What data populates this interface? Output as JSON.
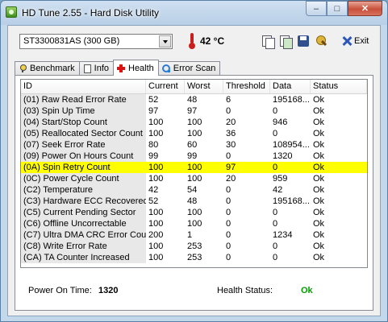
{
  "window": {
    "title": "HD Tune 2.55 - Hard Disk Utility"
  },
  "toolbar": {
    "drive": "ST3300831AS (300 GB)",
    "temperature": "42 °C",
    "exit_label": "Exit"
  },
  "tabs": [
    {
      "label": "Benchmark"
    },
    {
      "label": "Info"
    },
    {
      "label": "Health"
    },
    {
      "label": "Error Scan"
    }
  ],
  "health": {
    "columns": [
      "ID",
      "Current",
      "Worst",
      "Threshold",
      "Data",
      "Status"
    ],
    "rows": [
      [
        "(01) Raw Read Error Rate",
        "52",
        "48",
        "6",
        "195168...",
        "Ok"
      ],
      [
        "(03) Spin Up Time",
        "97",
        "97",
        "0",
        "0",
        "Ok"
      ],
      [
        "(04) Start/Stop Count",
        "100",
        "100",
        "20",
        "946",
        "Ok"
      ],
      [
        "(05) Reallocated Sector Count",
        "100",
        "100",
        "36",
        "0",
        "Ok"
      ],
      [
        "(07) Seek Error Rate",
        "80",
        "60",
        "30",
        "108954...",
        "Ok"
      ],
      [
        "(09) Power On Hours Count",
        "99",
        "99",
        "0",
        "1320",
        "Ok"
      ],
      [
        "(0A) Spin Retry Count",
        "100",
        "100",
        "97",
        "0",
        "Ok"
      ],
      [
        "(0C) Power Cycle Count",
        "100",
        "100",
        "20",
        "959",
        "Ok"
      ],
      [
        "(C2) Temperature",
        "42",
        "54",
        "0",
        "42",
        "Ok"
      ],
      [
        "(C3) Hardware ECC Recovered",
        "52",
        "48",
        "0",
        "195168...",
        "Ok"
      ],
      [
        "(C5) Current Pending Sector",
        "100",
        "100",
        "0",
        "0",
        "Ok"
      ],
      [
        "(C6) Offline Uncorrectable",
        "100",
        "100",
        "0",
        "0",
        "Ok"
      ],
      [
        "(C7) Ultra DMA CRC Error Count",
        "200",
        "1",
        "0",
        "1234",
        "Ok"
      ],
      [
        "(C8) Write Error Rate",
        "100",
        "253",
        "0",
        "0",
        "Ok"
      ],
      [
        "(CA) TA Counter Increased",
        "100",
        "253",
        "0",
        "0",
        "Ok"
      ]
    ],
    "highlight_color": "#ffff00"
  },
  "status_bar": {
    "power_on_label": "Power On Time:",
    "power_on_value": "1320",
    "health_label": "Health Status:",
    "health_value": "Ok",
    "health_color": "#00a000"
  }
}
